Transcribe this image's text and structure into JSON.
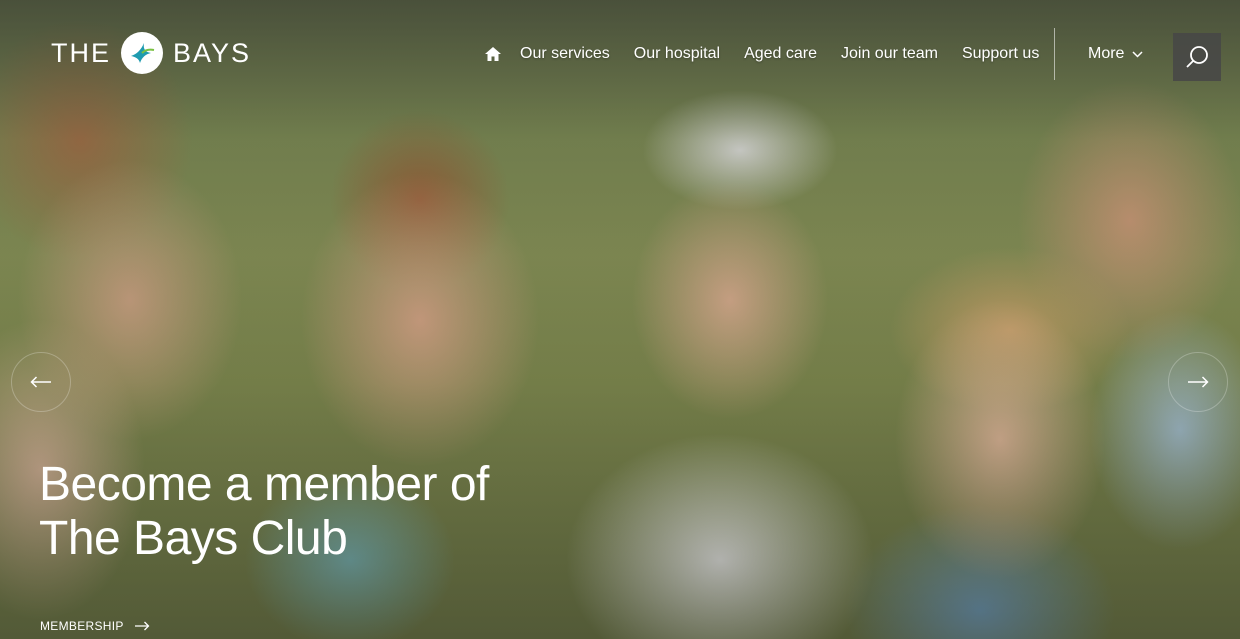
{
  "brand": {
    "left": "THE",
    "right": "BAYS",
    "accent": "#1f9bb0"
  },
  "nav": {
    "home_icon": "home-icon",
    "links": [
      "Our services",
      "Our hospital",
      "Aged care",
      "Join our team",
      "Support us"
    ],
    "more": "More",
    "search_icon": "search-icon"
  },
  "slider": {
    "prev_icon": "arrow-left-icon",
    "next_icon": "arrow-right-icon",
    "headline_line1": "Become a member of",
    "headline_line2": "The Bays Club",
    "cta": "MEMBERSHIP"
  }
}
